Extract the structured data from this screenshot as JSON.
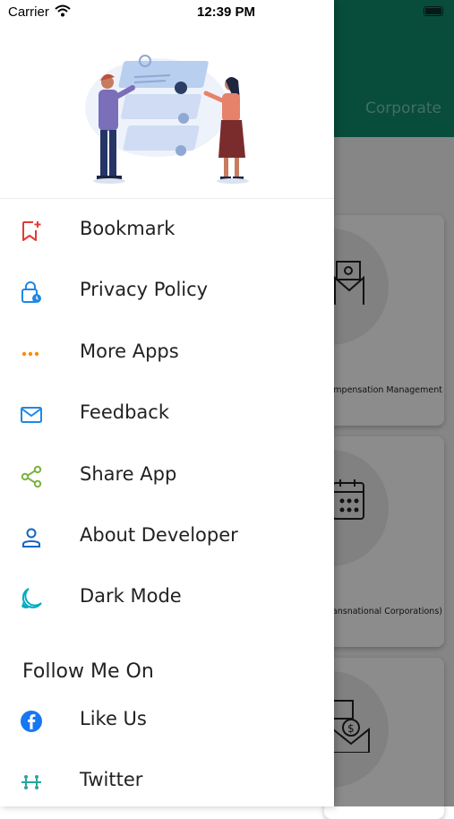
{
  "status_bar": {
    "carrier": "Carrier",
    "time": "12:39 PM"
  },
  "background_app": {
    "header_title": "Corporate",
    "accent_color": "#0f8a6d",
    "cards": [
      {
        "caption": "mpensation Management"
      },
      {
        "caption": "ics (Transnational Corporations)"
      }
    ]
  },
  "drawer": {
    "menu": [
      {
        "label": "Bookmark",
        "icon": "bookmark-add-icon",
        "color": "#e53935"
      },
      {
        "label": "Privacy Policy",
        "icon": "lock-clock-icon",
        "color": "#1e88e5"
      },
      {
        "label": "More Apps",
        "icon": "more-dots-icon",
        "color": "#fb8c00"
      },
      {
        "label": "Feedback",
        "icon": "mail-icon",
        "color": "#1e88e5"
      },
      {
        "label": "Share App",
        "icon": "share-icon",
        "color": "#7cb342"
      },
      {
        "label": "About Developer",
        "icon": "person-icon",
        "color": "#1565c0"
      },
      {
        "label": "Dark Mode",
        "icon": "moon-icon",
        "color": "#00acc1"
      }
    ],
    "follow_title": "Follow Me On",
    "social": [
      {
        "label": "Like Us",
        "icon": "facebook-icon",
        "color": "#1877f2"
      },
      {
        "label": "Twitter",
        "icon": "twitter-icon",
        "color": "#26a69a"
      }
    ]
  }
}
